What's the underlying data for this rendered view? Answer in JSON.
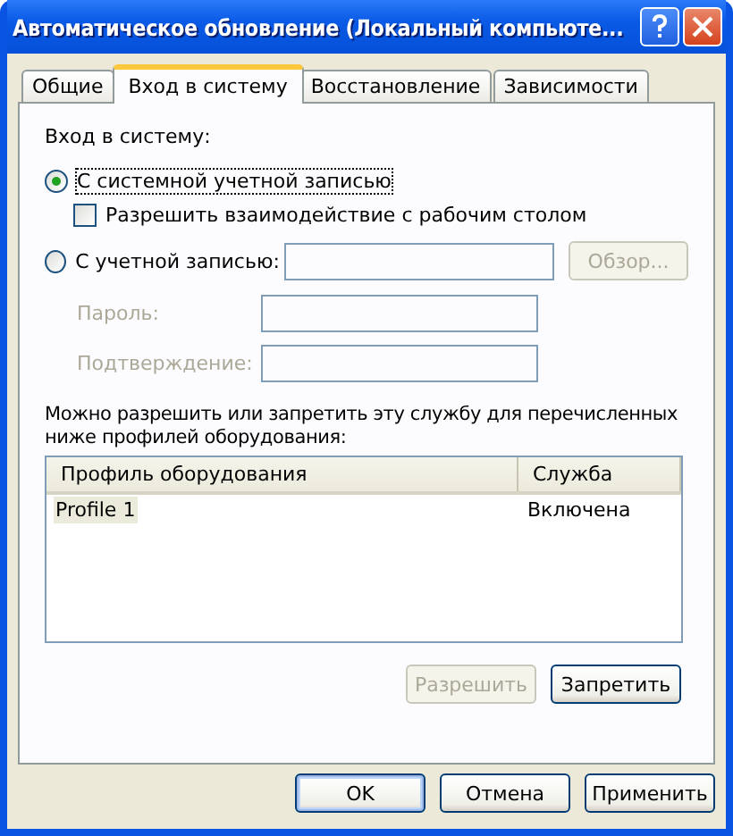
{
  "window": {
    "title": "Автоматическое обновление (Локальный компьюте..."
  },
  "tabs": [
    {
      "label": "Общие",
      "selected": false
    },
    {
      "label": "Вход в систему",
      "selected": true
    },
    {
      "label": "Восстановление",
      "selected": false
    },
    {
      "label": "Зависимости",
      "selected": false
    }
  ],
  "logon": {
    "heading": "Вход в систему:",
    "system_account": {
      "label": "С системной учетной записью",
      "selected": true
    },
    "desktop_interaction": {
      "label": "Разрешить взаимодействие с рабочим столом",
      "checked": false
    },
    "this_account": {
      "label": "С учетной записью:",
      "selected": false
    },
    "browse_button": {
      "label": "Обзор...",
      "disabled": true
    },
    "fields": [
      {
        "label": "Пароль:",
        "disabled": true
      },
      {
        "label": "Подтверждение:",
        "disabled": true
      }
    ]
  },
  "profiles": {
    "note": "Можно разрешить или запретить эту службу для перечисленных ниже профилей оборудования:",
    "columns": [
      "Профиль оборудования",
      "Служба"
    ],
    "rows": [
      {
        "cells": [
          "Profile 1",
          "Включена"
        ],
        "selected": true
      }
    ],
    "buttons": [
      {
        "label": "Разрешить",
        "disabled": true
      },
      {
        "label": "Запретить",
        "disabled": false
      }
    ]
  },
  "footer_buttons": [
    {
      "label": "OK",
      "default": true
    },
    {
      "label": "Отмена",
      "default": false
    },
    {
      "label": "Применить",
      "default": false
    }
  ]
}
